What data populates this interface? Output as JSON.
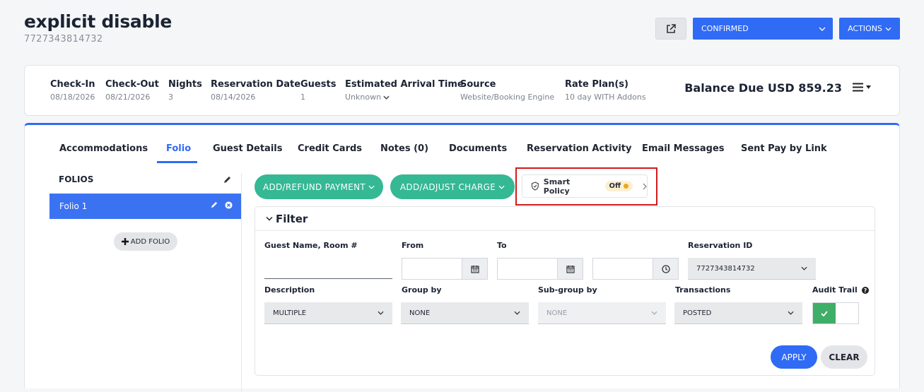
{
  "header": {
    "title": "explicit disable",
    "reservation_number": "7727343814732",
    "status_label": "CONFIRMED",
    "actions_label": "ACTIONS"
  },
  "info": {
    "check_in_label": "Check-In",
    "check_in": "08/18/2026",
    "check_out_label": "Check-Out",
    "check_out": "08/21/2026",
    "nights_label": "Nights",
    "nights": "3",
    "reservation_date_label": "Reservation Date",
    "reservation_date": "08/14/2026",
    "guests_label": "Guests",
    "guests": "1",
    "eta_label": "Estimated Arrival Time",
    "eta": "Unknown",
    "source_label": "Source",
    "source": "Website/Booking Engine",
    "rate_plan_label": "Rate Plan(s)",
    "rate_plan": "10 day WITH Addons",
    "balance": "Balance Due USD 859.23"
  },
  "tabs": [
    {
      "label": "Accommodations"
    },
    {
      "label": "Folio"
    },
    {
      "label": "Guest Details"
    },
    {
      "label": "Credit Cards"
    },
    {
      "label": "Notes (0)"
    },
    {
      "label": "Documents"
    },
    {
      "label": "Reservation Activity"
    },
    {
      "label": "Email Messages"
    },
    {
      "label": "Sent Pay by Link"
    }
  ],
  "folios": {
    "heading": "FOLIOS",
    "items": [
      {
        "label": "Folio 1"
      }
    ],
    "add_label": "ADD FOLIO"
  },
  "toolbar": {
    "add_refund_payment": "ADD/REFUND PAYMENT",
    "add_adjust_charge": "ADD/ADJUST CHARGE",
    "smart_policy": "Smart Policy",
    "smart_policy_state": "Off"
  },
  "filter": {
    "heading": "Filter",
    "guest_name_label": "Guest Name, Room #",
    "from_label": "From",
    "to_label": "To",
    "reservation_id_label": "Reservation ID",
    "reservation_id_value": "7727343814732",
    "description_label": "Description",
    "description_value": "MULTIPLE",
    "group_by_label": "Group by",
    "group_by_value": "NONE",
    "subgroup_label": "Sub-group by",
    "subgroup_value": "NONE",
    "transactions_label": "Transactions",
    "transactions_value": "POSTED",
    "audit_trail_label": "Audit Trail",
    "audit_trail_on": true,
    "apply_label": "APPLY",
    "clear_label": "CLEAR"
  },
  "colors": {
    "primary": "#2f6bf4",
    "green": "#35b894",
    "highlight": "#d21a1a"
  }
}
